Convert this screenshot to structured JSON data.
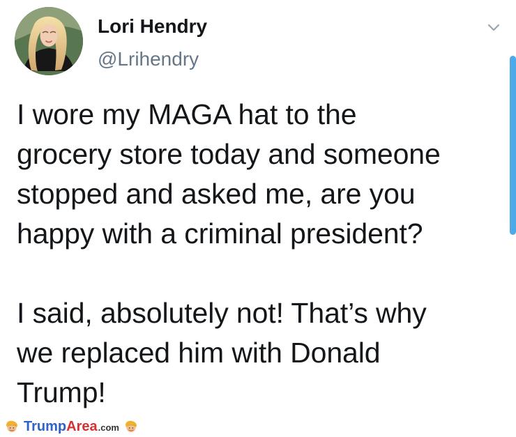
{
  "tweet": {
    "author": {
      "name": "Lori Hendry",
      "handle": "@Lrihendry"
    },
    "text": "I wore my MAGA hat to the\ngrocery store today and someone\nstopped and asked me, are you\nhappy with a criminal president?\n\nI said, absolutely not! That’s why\nwe replaced him with Donald\nTrump!"
  },
  "watermark": {
    "brand_part_1": "Trump",
    "brand_part_2": "Area",
    "domain_suffix": ".com"
  },
  "icons": {
    "menu": "chevron-down-icon",
    "watermark_left": "trump-face-icon",
    "watermark_right": "trump-face-icon"
  },
  "colors": {
    "name": "#14171a",
    "handle": "#657786",
    "scrollbar": "#45a4e8",
    "watermark_trump": "#2f63c8",
    "watermark_area": "#d93131",
    "watermark_domain": "#333333"
  }
}
